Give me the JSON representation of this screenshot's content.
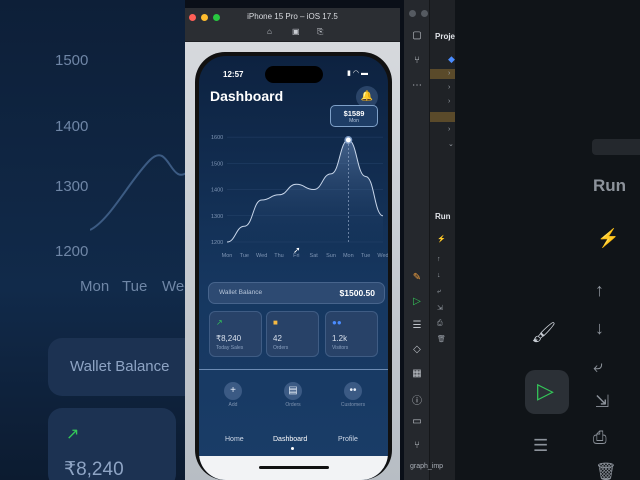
{
  "simulator": {
    "title": "iPhone 15 Pro – iOS 17.5",
    "tools": [
      "home-icon",
      "screenshot-icon",
      "rotate-icon"
    ]
  },
  "phone": {
    "status_time": "12:57",
    "title": "Dashboard",
    "tooltip": {
      "value": "$1589",
      "label": "Mon"
    },
    "wallet": {
      "label": "Wallet Balance",
      "value": "$1500.50"
    },
    "stats": [
      {
        "value": "₹8,240",
        "label": "Today Sales",
        "icon": "trend-up-icon",
        "color": "#34c759"
      },
      {
        "value": "42",
        "label": "Orders",
        "icon": "bag-icon",
        "color": "#f5b942"
      },
      {
        "value": "1.2k",
        "label": "Visitors",
        "icon": "users-icon",
        "color": "#4a8cff"
      }
    ],
    "actions": [
      {
        "label": "Add",
        "icon": "plus-icon"
      },
      {
        "label": "Orders",
        "icon": "archive-icon"
      },
      {
        "label": "Customers",
        "icon": "users-icon"
      }
    ],
    "nav": [
      {
        "label": "Home"
      },
      {
        "label": "Dashboard",
        "active": true
      },
      {
        "label": "Profile"
      }
    ]
  },
  "chart_data": {
    "type": "area",
    "x": [
      "Mon",
      "Tue",
      "Wed",
      "Thu",
      "Fri",
      "Sat",
      "Sun",
      "Mon",
      "Tue",
      "Wed"
    ],
    "y_ticks": [
      1200,
      1300,
      1400,
      1500,
      1600
    ],
    "ylim": [
      1200,
      1650
    ],
    "series": [
      {
        "values": [
          1200,
          1260,
          1360,
          1380,
          1420,
          1400,
          1460,
          1589,
          1450,
          1300
        ]
      }
    ],
    "highlight": {
      "x": "Mon",
      "y": 1589
    },
    "grid": true
  },
  "background": {
    "left_ticks": [
      "1500",
      "1400",
      "1300",
      "1200"
    ],
    "left_days": [
      "Mon",
      "Tue",
      "Wed"
    ],
    "left_wallet": "Wallet Balance",
    "left_sales": "₹8,240",
    "right_run": "Run"
  },
  "xcode": {
    "project_label": "Proje",
    "run_label": "Run",
    "footer": "graph_imp"
  }
}
